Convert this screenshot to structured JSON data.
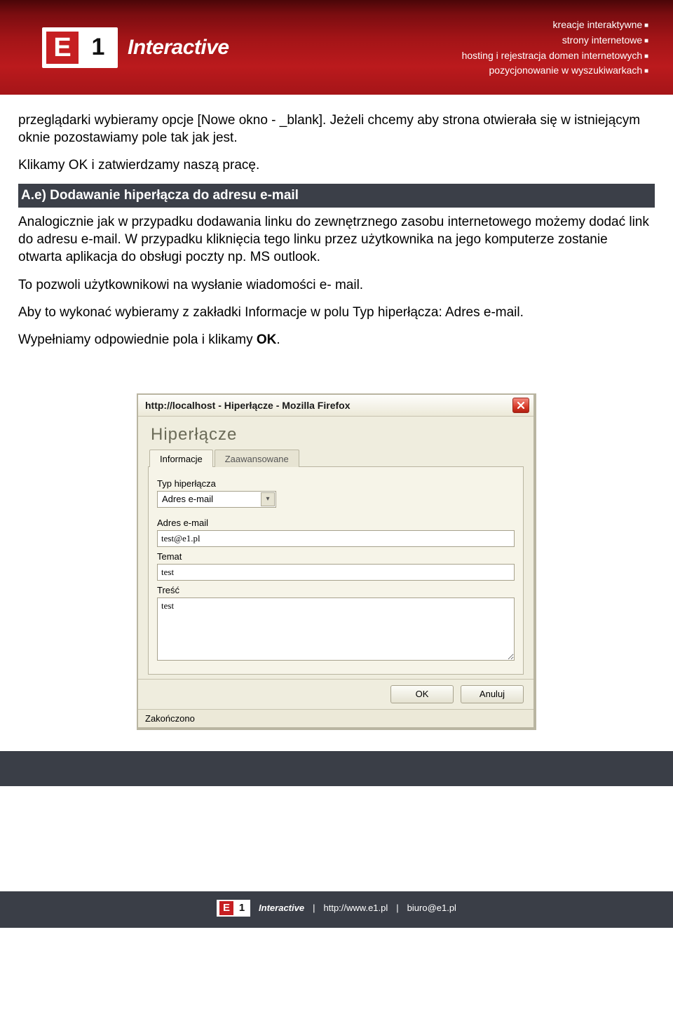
{
  "header": {
    "brand_e": "E",
    "brand_1": "1",
    "brand_text": "Interactive",
    "taglines": [
      "kreacje interaktywne",
      "strony internetowe",
      "hosting i rejestracja domen internetowych",
      "pozycjonowanie w wyszukiwarkach"
    ]
  },
  "article": {
    "p1": "przeglądarki wybieramy opcje [Nowe okno - _blank]. Jeżeli chcemy aby strona otwierała się w istniejącym oknie pozostawiamy pole tak jak jest.",
    "p2": "Klikamy OK i zatwierdzamy naszą pracę.",
    "section_title": "A.e) Dodawanie hiperłącza do adresu e-mail",
    "p3": "Analogicznie jak w przypadku dodawania linku do zewnętrznego zasobu internetowego możemy dodać link do adresu e-mail. W przypadku kliknięcia tego linku przez użytkownika na jego komputerze zostanie otwarta aplikacja do obsługi poczty np. MS outlook.",
    "p4": "To pozwoli użytkownikowi na wysłanie wiadomości e- mail.",
    "p5": "Aby to wykonać wybieramy z zakładki Informacje w polu Typ hiperłącza: Adres e-mail.",
    "p6_prefix": "Wypełniamy odpowiednie pola i klikamy ",
    "p6_bold": "OK",
    "p6_suffix": "."
  },
  "dialog": {
    "title": "http://localhost - Hiperłącze - Mozilla Firefox",
    "heading": "Hiperłącze",
    "tab_info": "Informacje",
    "tab_adv": "Zaawansowane",
    "lbl_type": "Typ hiperłącza",
    "val_type": "Adres e-mail",
    "lbl_email": "Adres e-mail",
    "val_email": "test@e1.pl",
    "lbl_subject": "Temat",
    "val_subject": "test",
    "lbl_body": "Treść",
    "val_body": "test",
    "btn_ok": "OK",
    "btn_cancel": "Anuluj",
    "status": "Zakończono"
  },
  "footer": {
    "brand_e": "E",
    "brand_1": "1",
    "brand_text": "Interactive",
    "url": "http://www.e1.pl",
    "email": "biuro@e1.pl",
    "sep": "|"
  }
}
